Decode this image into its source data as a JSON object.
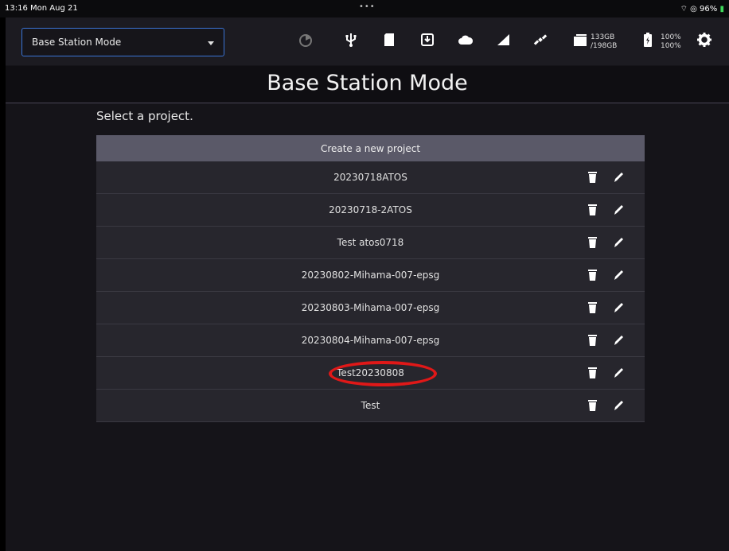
{
  "status_bar": {
    "time": "13:16  Mon Aug 21",
    "dots": "•••",
    "system": "⌔ ◎ 96%",
    "battery_glyph": "▮"
  },
  "toolbar": {
    "mode_select_value": "Base Station Mode",
    "icons": [
      "timer-icon",
      "usb-icon",
      "sd-card-icon",
      "download-icon",
      "cloud-icon",
      "signal-icon",
      "satellite-icon",
      "folder-icon",
      "battery-icon",
      "gear-icon"
    ],
    "storage_used": "133GB",
    "storage_total": "/198GB",
    "battery_top": "100%",
    "battery_bottom": "100%"
  },
  "page": {
    "title": "Base Station Mode",
    "hint": "Select a project.",
    "create_label": "Create a new project"
  },
  "projects": [
    {
      "name": "20230718ATOS"
    },
    {
      "name": "20230718-2ATOS"
    },
    {
      "name": "Test atos0718"
    },
    {
      "name": "20230802-Mihama-007-epsg"
    },
    {
      "name": "20230803-Mihama-007-epsg"
    },
    {
      "name": "20230804-Mihama-007-epsg"
    },
    {
      "name": "Test20230808"
    },
    {
      "name": "Test"
    }
  ],
  "colors": {
    "accent": "#3a74d6",
    "highlight": "#e01818",
    "row_bg": "#27262d",
    "create_bg": "#5a5968"
  }
}
